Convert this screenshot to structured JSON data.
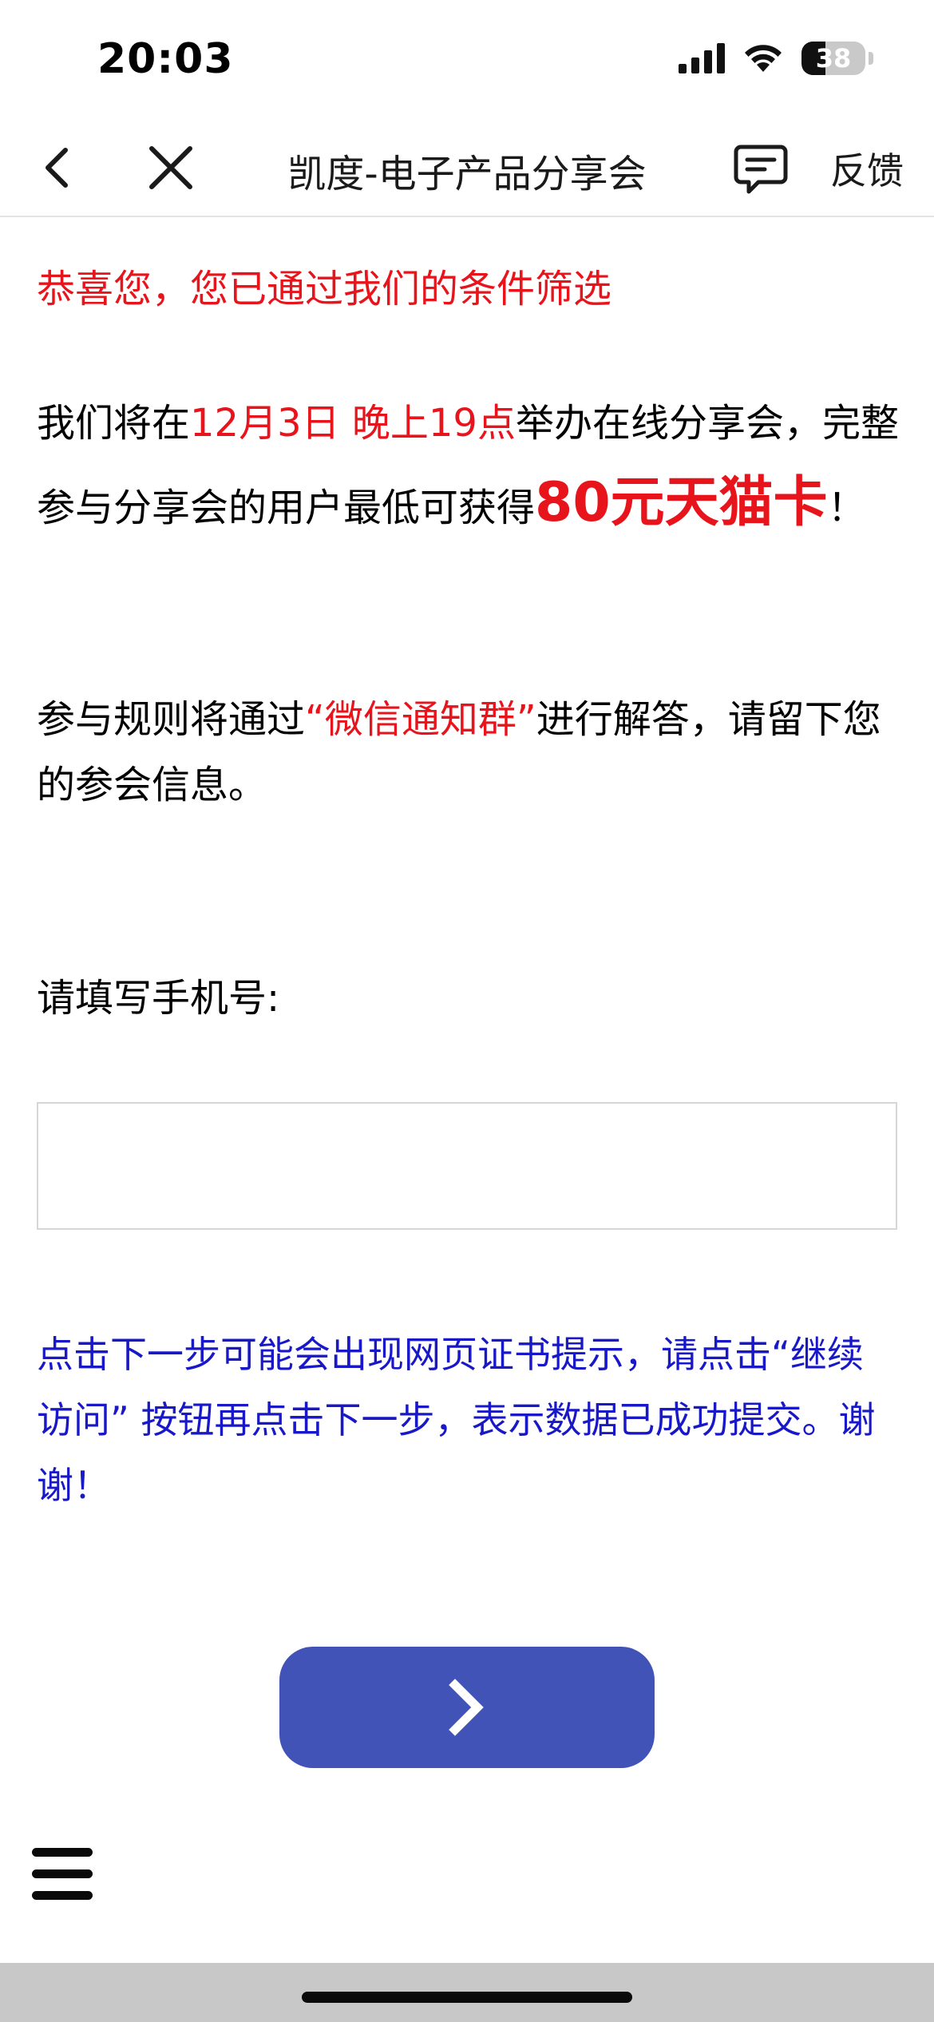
{
  "status_bar": {
    "time": "20:03",
    "battery_level": "38",
    "battery_fraction": 0.38,
    "icons": [
      "signal-icon",
      "wifi-icon",
      "battery-icon"
    ]
  },
  "nav": {
    "title": "凯度-电子产品分享会",
    "feedback_label": "反馈",
    "icons": [
      "back-icon",
      "close-icon",
      "feedback-icon"
    ]
  },
  "content": {
    "congrats": "恭喜您，您已通过我们的条件筛选",
    "para1": {
      "part1": "我们将在",
      "date_highlight": "12月3日 晚上19点",
      "part2": "举办在线分享会，完整参与分享会的用户最低可获得",
      "reward_highlight": "80元天猫卡",
      "part3": "！"
    },
    "para2": {
      "part1": "参与规则将通过",
      "group_highlight": "“微信通知群”",
      "part2": "进行解答，请留下您的参会信息。"
    },
    "phone_label": "请填写手机号:",
    "phone_value": "",
    "note": "点击下一步可能会出现网页证书提示，请点击“继续访问” 按钮再点击下一步，表示数据已成功提交。谢谢！"
  },
  "actions": {
    "next_icon": "chevron-right-icon",
    "menu_icon": "menu-icon"
  },
  "colors": {
    "highlight_red": "#e8141c",
    "note_blue": "#1818c8",
    "button_blue": "#4253b8"
  }
}
